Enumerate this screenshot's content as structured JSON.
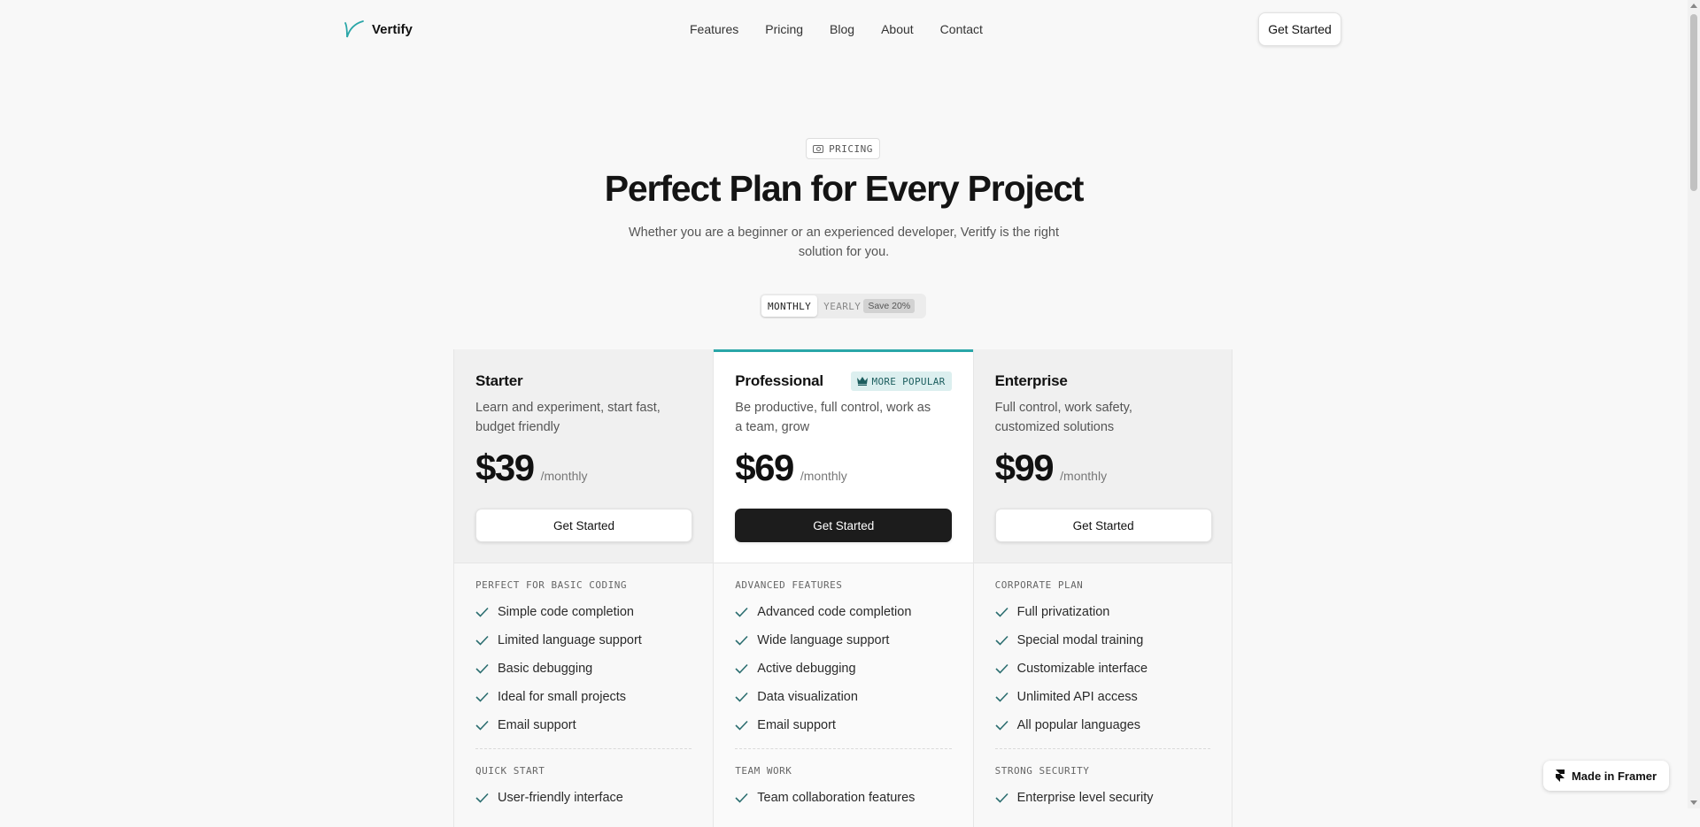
{
  "nav": {
    "logo_text": "Vertify",
    "links": [
      "Features",
      "Pricing",
      "Blog",
      "About",
      "Contact"
    ],
    "cta": "Get Started"
  },
  "hero": {
    "pill": "PRICING",
    "title": "Perfect Plan for Every Project",
    "subtitle": "Whether you are a beginner or an experienced developer, Veritfy is the right solution for you."
  },
  "billing": {
    "monthly": "MONTHLY",
    "yearly": "YEARLY",
    "save": "Save 20%",
    "selected": "MONTHLY"
  },
  "plans": [
    {
      "name": "Starter",
      "desc": "Learn and experiment, start fast, budget friendly",
      "price": "$39",
      "period": "/monthly",
      "cta": "Get Started",
      "sections": [
        {
          "title": "PERFECT FOR BASIC CODING",
          "features": [
            "Simple code completion",
            "Limited language support",
            "Basic debugging",
            "Ideal for small projects",
            "Email support"
          ]
        },
        {
          "title": "QUICK START",
          "features": [
            "User-friendly interface"
          ]
        }
      ]
    },
    {
      "name": "Professional",
      "badge": "MORE POPULAR",
      "desc": "Be productive, full control, work as a team, grow",
      "price": "$69",
      "period": "/monthly",
      "cta": "Get Started",
      "sections": [
        {
          "title": "ADVANCED FEATURES",
          "features": [
            "Advanced code completion",
            "Wide language support",
            "Active debugging",
            "Data visualization",
            "Email support"
          ]
        },
        {
          "title": "TEAM WORK",
          "features": [
            "Team collaboration features"
          ]
        }
      ]
    },
    {
      "name": "Enterprise",
      "desc": "Full control, work safety, customized solutions",
      "price": "$99",
      "period": "/monthly",
      "cta": "Get Started",
      "sections": [
        {
          "title": "CORPORATE PLAN",
          "features": [
            "Full privatization",
            "Special modal training",
            "Customizable interface",
            "Unlimited API access",
            "All popular languages"
          ]
        },
        {
          "title": "STRONG SECURITY",
          "features": [
            "Enterprise level security"
          ]
        }
      ]
    }
  ],
  "framer_badge": "Made in Framer",
  "colors": {
    "accent": "#2aa6a8",
    "badge_bg": "#dcefef",
    "primary_button": "#1c1c1c"
  }
}
